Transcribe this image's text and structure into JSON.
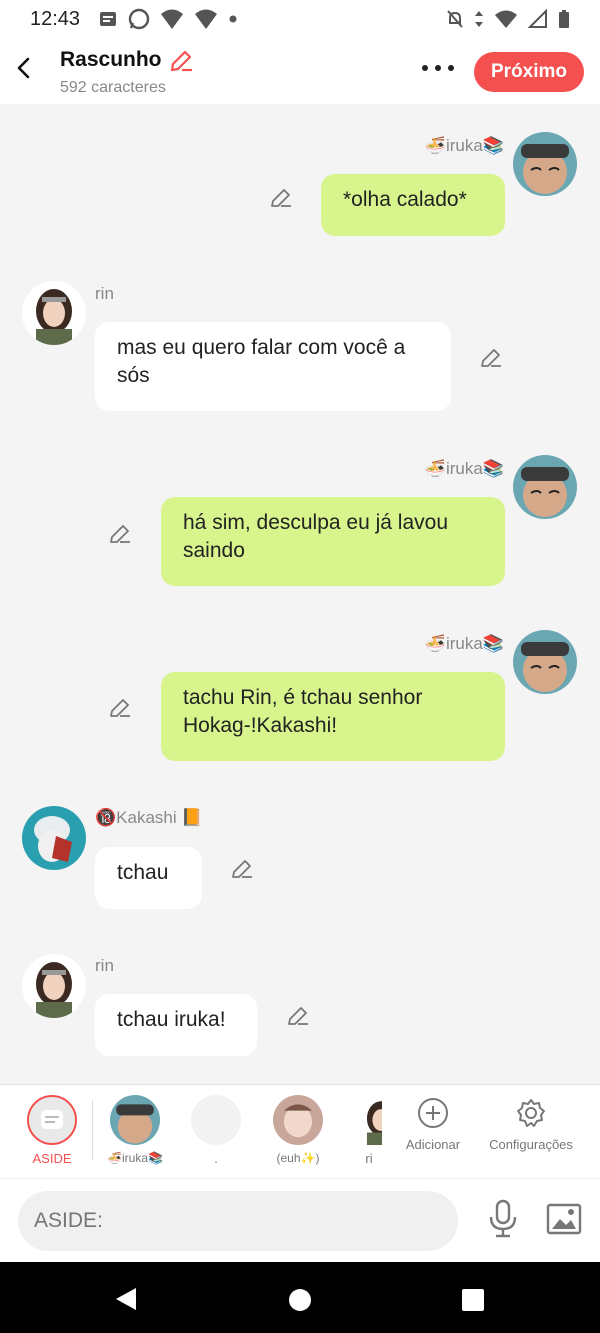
{
  "status": {
    "time": "12:43"
  },
  "header": {
    "title": "Rascunho",
    "subtitle": "592 caracteres",
    "next_label": "Próximo"
  },
  "colors": {
    "accent": "#f45050",
    "my_bubble": "#d8f48c",
    "other_bubble": "#ffffff"
  },
  "messages": [
    {
      "author": "🍜iruka📚",
      "text": "*olha calado*",
      "side": "right"
    },
    {
      "author": "rin",
      "text": "mas eu quero falar com você a sós",
      "side": "left"
    },
    {
      "author": "🍜iruka📚",
      "text": "há sim, desculpa eu já lavou saindo",
      "side": "right"
    },
    {
      "author": "🍜iruka📚",
      "text": "tachu Rin, é tchau senhor Hokag-!Kakashi!",
      "side": "right"
    },
    {
      "author": "🔞Kakashi 📙",
      "text": "tchau",
      "side": "left"
    },
    {
      "author": "rin",
      "text": "tchau iruka!",
      "side": "left"
    }
  ],
  "tabs": [
    {
      "label": "ASIDE",
      "icon": "aside-icon"
    },
    {
      "label": "🍜iruka📚"
    },
    {
      "label": "."
    },
    {
      "label": "(euh✨)"
    },
    {
      "label": "ri"
    },
    {
      "label": "Adicionar",
      "icon": "plus-circle-icon"
    },
    {
      "label": "Configurações",
      "icon": "gear-icon"
    }
  ],
  "composer": {
    "placeholder": "ASIDE:"
  }
}
